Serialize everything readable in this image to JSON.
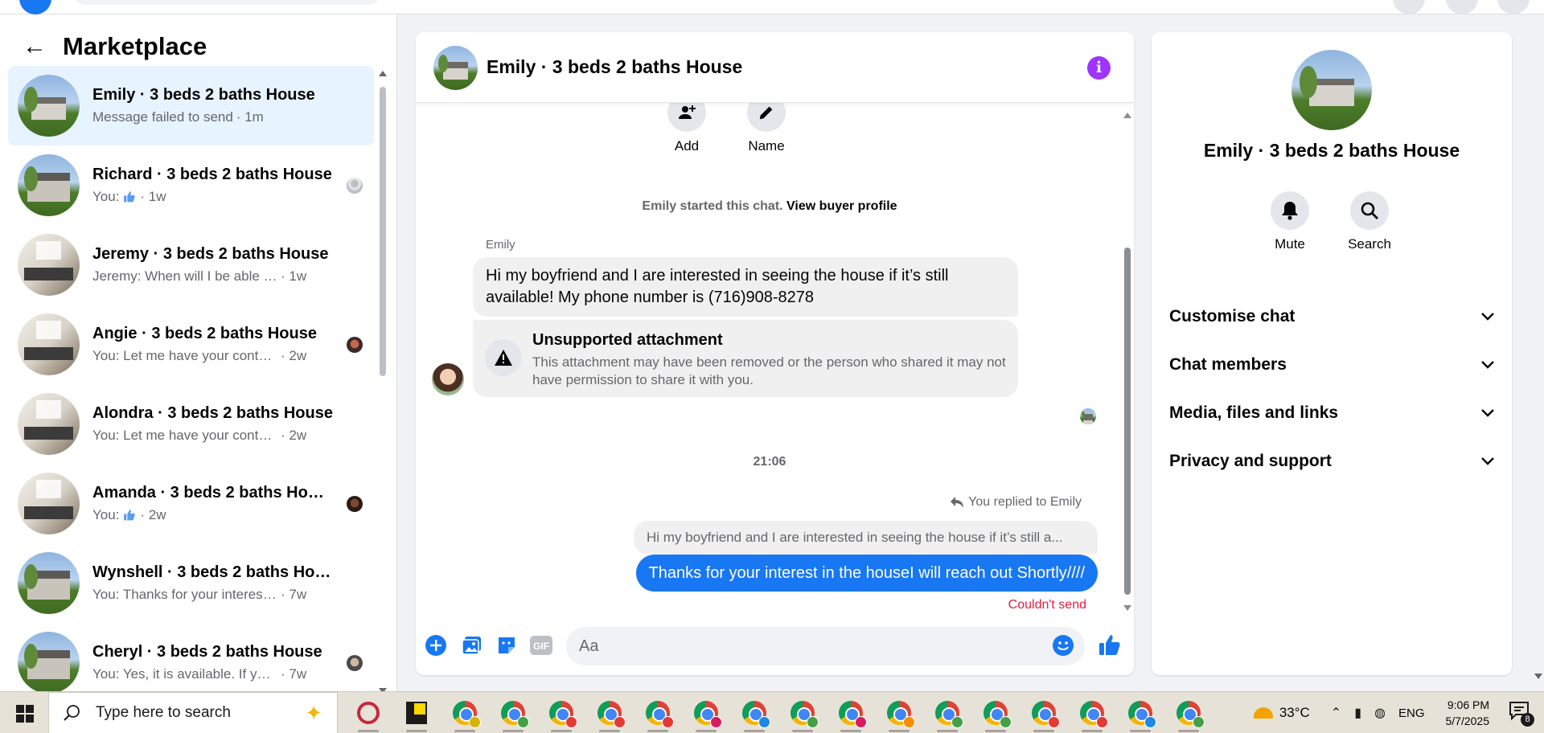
{
  "left_panel": {
    "title": "Marketplace",
    "conversations": [
      {
        "name": "Emily · 3 beds 2 baths House",
        "preview": "Message failed to send",
        "time": "· 1m",
        "avatar": "house-exterior-icon",
        "active": true,
        "thumb": false
      },
      {
        "name": "Richard · 3 beds 2 baths House",
        "preview": "You: ",
        "time": "· 1w",
        "avatar": "house-two-story-icon",
        "active": false,
        "thumb": true
      },
      {
        "name": "Jeremy · 3 beds 2 baths House",
        "preview": "Jeremy: When will I be able to get ...",
        "time": "· 1w",
        "avatar": "interior-icon",
        "active": false,
        "thumb": false
      },
      {
        "name": "Angie · 3 beds 2 baths House",
        "preview": "You: Let me have your contact n...",
        "time": "· 2w",
        "avatar": "interior-icon",
        "active": false,
        "thumb": false
      },
      {
        "name": "Alondra · 3 beds 2 baths House",
        "preview": "You: Let me have your contact num...",
        "time": "· 2w",
        "avatar": "interior-icon",
        "active": false,
        "thumb": false
      },
      {
        "name": "Amanda · 3 beds 2 baths House",
        "preview": "You: ",
        "time": "· 2w",
        "avatar": "interior-icon",
        "active": false,
        "thumb": true
      },
      {
        "name": "Wynshell · 3 beds 2 baths House",
        "preview": "You: Thanks for your interest in the...",
        "time": "· 7w",
        "avatar": "house-two-story-icon",
        "active": false,
        "thumb": false
      },
      {
        "name": "Cheryl · 3 beds 2 baths House",
        "preview": "You: Yes, it is available. If you are...",
        "time": "· 7w",
        "avatar": "house-two-story-icon",
        "active": false,
        "thumb": false
      }
    ]
  },
  "chat": {
    "title": "Emily · 3 beds 2 baths House",
    "actions": {
      "add": "Add",
      "name": "Name"
    },
    "started_text": "Emily started this chat.",
    "view_profile": "View buyer profile",
    "sender": "Emily",
    "incoming_message": "Hi my boyfriend and I are interested in seeing the house if it’s still available! My phone number is (716)908-8278",
    "attachment_title": "Unsupported attachment",
    "attachment_desc": "This attachment may have been removed or the person who shared it may not have permission to share it with you.",
    "timestamp": "21:06",
    "replied_label": "You replied to Emily",
    "quoted_text": "Hi my boyfriend and I are interested in seeing the house if it’s still a...",
    "outgoing_message": "Thanks for your interest in the houseI will reach out Shortly////",
    "fail_text": "Couldn't send",
    "composer_placeholder": "Aa"
  },
  "right_panel": {
    "title": "Emily · 3 beds 2 baths House",
    "actions": {
      "mute": "Mute",
      "search": "Search"
    },
    "sections": [
      "Customise chat",
      "Chat members",
      "Media, files and links",
      "Privacy and support"
    ]
  },
  "taskbar": {
    "search_placeholder": "Type here to search",
    "temperature": "33°C",
    "language": "ENG",
    "time": "9:06 PM",
    "date": "5/7/2025",
    "notification_count": "8",
    "badge_colors": [
      "#d6b300",
      "#43a047",
      "#e53935",
      "#e53935",
      "#e53935",
      "#d81b60",
      "#1e88e5",
      "#43a047",
      "#d81b60",
      "#fb8c00",
      "#43a047",
      "#43a047",
      "#e53935",
      "#e53935",
      "#1e88e5",
      "#43a047"
    ]
  },
  "colors": {
    "accent": "#1877f2",
    "error": "#e41e3f",
    "info": "#a033ff",
    "active_row": "#e7f3ff"
  }
}
